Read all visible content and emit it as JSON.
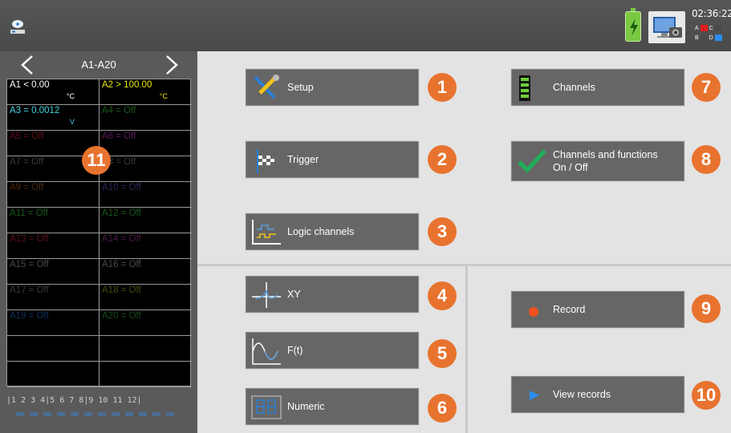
{
  "topbar": {
    "clock": "02:36:22",
    "legend": [
      "A",
      "C",
      "B",
      "D"
    ]
  },
  "channels_panel": {
    "range_title": "A1-A20",
    "cells": [
      {
        "label": "A1 <  0.00",
        "unit": "°C",
        "color": "#ffffff"
      },
      {
        "label": "A2 > 100.00",
        "unit": "°C",
        "color": "#e6e600"
      },
      {
        "label": "A3 = 0.0012",
        "unit": "V",
        "color": "#3fd6e0"
      },
      {
        "label": "A4 = Off",
        "unit": "",
        "color": "#1a5a1a"
      },
      {
        "label": "A5 = Off",
        "unit": "",
        "color": "#5a1018"
      },
      {
        "label": "A6 = Off",
        "unit": "",
        "color": "#5a1a5a"
      },
      {
        "label": "A7 = Off",
        "unit": "",
        "color": "#3a3a3a"
      },
      {
        "label": "A8 = Off",
        "unit": "",
        "color": "#3a3a3a"
      },
      {
        "label": "A9 = Off",
        "unit": "",
        "color": "#4a2a10"
      },
      {
        "label": "A10 = Off",
        "unit": "",
        "color": "#2a2a5a"
      },
      {
        "label": "A11 = Off",
        "unit": "",
        "color": "#1a5a1a"
      },
      {
        "label": "A12 = Off",
        "unit": "",
        "color": "#1a5a1a"
      },
      {
        "label": "A13 = Off",
        "unit": "",
        "color": "#5a1018"
      },
      {
        "label": "A14 = Off",
        "unit": "",
        "color": "#4a1a4a"
      },
      {
        "label": "A15 = Off",
        "unit": "",
        "color": "#4a4a4a"
      },
      {
        "label": "A16 = Off",
        "unit": "",
        "color": "#4a4a4a"
      },
      {
        "label": "A17 = Off",
        "unit": "",
        "color": "#3a3a3a"
      },
      {
        "label": "A18 = Off",
        "unit": "",
        "color": "#4a4a10"
      },
      {
        "label": "A19 = Off",
        "unit": "",
        "color": "#10305a"
      },
      {
        "label": "A20 = Off",
        "unit": "",
        "color": "#1a4a1a"
      },
      {
        "label": "",
        "unit": "",
        "color": "#000"
      },
      {
        "label": "",
        "unit": "",
        "color": "#000"
      },
      {
        "label": "",
        "unit": "",
        "color": "#000"
      },
      {
        "label": "",
        "unit": "",
        "color": "#000"
      }
    ],
    "callout": "11",
    "pages": "|1  2  3  4|5  6  7  8|9  10 11 12|"
  },
  "buttons": {
    "setup": {
      "label": "Setup",
      "num": "1"
    },
    "trigger": {
      "label": "Trigger",
      "num": "2"
    },
    "logic": {
      "label": "Logic channels",
      "num": "3"
    },
    "xy": {
      "label": "XY",
      "num": "4"
    },
    "ft": {
      "label": "F(t)",
      "num": "5"
    },
    "numeric": {
      "label": "Numeric",
      "num": "6"
    },
    "channels": {
      "label": "Channels",
      "num": "7"
    },
    "chfunc": {
      "label1": "Channels and functions",
      "label2": "On / Off",
      "num": "8"
    },
    "record": {
      "label": "Record",
      "num": "9"
    },
    "view": {
      "label": "View records",
      "num": "10"
    }
  },
  "colors": {
    "accent": "#e8732f",
    "button_bg": "#666666",
    "panel_bg": "#e3e3e3"
  }
}
